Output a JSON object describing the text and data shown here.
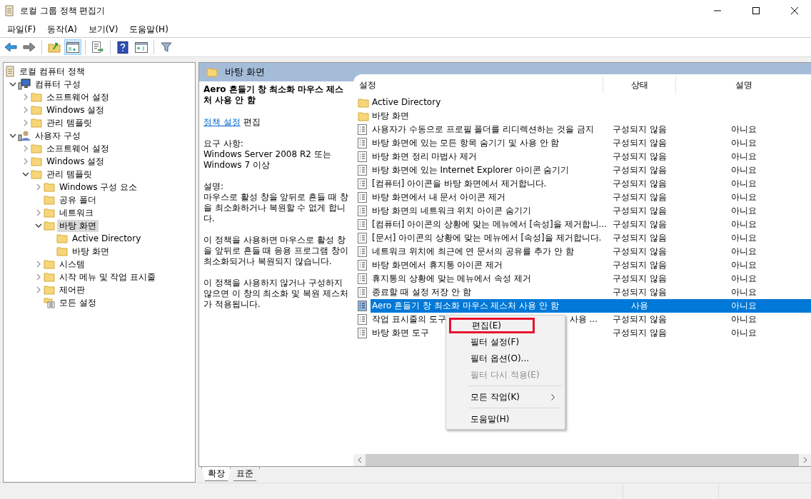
{
  "window": {
    "title": "로컬 그룹 정책 편집기"
  },
  "menu_bar": [
    "파일(F)",
    "동작(A)",
    "보기(V)",
    "도움말(H)"
  ],
  "toolbar": [
    {
      "kind": "back",
      "pressed": false
    },
    {
      "kind": "forward",
      "pressed": false
    },
    {
      "kind": "separator"
    },
    {
      "kind": "up",
      "pressed": false
    },
    {
      "kind": "tree",
      "pressed": true
    },
    {
      "kind": "separator"
    },
    {
      "kind": "export",
      "pressed": false
    },
    {
      "kind": "separator"
    },
    {
      "kind": "help",
      "pressed": false
    },
    {
      "kind": "pane",
      "pressed": false
    },
    {
      "kind": "separator"
    },
    {
      "kind": "filter",
      "pressed": false
    }
  ],
  "tree": {
    "label": "로컬 컴퓨터 정책",
    "kind": "policy",
    "selected": false,
    "children": [
      {
        "label": "컴퓨터 구성",
        "kind": "computer",
        "expanded": true,
        "selected": false,
        "children": [
          {
            "label": "소프트웨어 설정",
            "kind": "folder",
            "expanded": false,
            "selected": false
          },
          {
            "label": "Windows 설정",
            "kind": "folder",
            "expanded": false,
            "selected": false
          },
          {
            "label": "관리 템플릿",
            "kind": "folder",
            "expanded": false,
            "selected": false
          }
        ]
      },
      {
        "label": "사용자 구성",
        "kind": "user",
        "expanded": true,
        "selected": false,
        "children": [
          {
            "label": "소프트웨어 설정",
            "kind": "folder",
            "expanded": false,
            "selected": false
          },
          {
            "label": "Windows 설정",
            "kind": "folder",
            "expanded": false,
            "selected": false
          },
          {
            "label": "관리 템플릿",
            "kind": "folder",
            "expanded": true,
            "selected": false,
            "children": [
              {
                "label": "Windows 구성 요소",
                "kind": "folder",
                "expanded": false,
                "selected": false
              },
              {
                "label": "공유 폴더",
                "kind": "folder",
                "selected": false
              },
              {
                "label": "네트워크",
                "kind": "folder",
                "expanded": false,
                "selected": false
              },
              {
                "label": "바탕 화면",
                "kind": "folder",
                "expanded": true,
                "selected": true,
                "children": [
                  {
                    "label": "Active Directory",
                    "kind": "folder",
                    "selected": false
                  },
                  {
                    "label": "바탕 화면",
                    "kind": "folder",
                    "selected": false
                  }
                ]
              },
              {
                "label": "시스템",
                "kind": "folder",
                "expanded": false,
                "selected": false
              },
              {
                "label": "시작 메뉴 및 작업 표시줄",
                "kind": "folder",
                "expanded": false,
                "selected": false
              },
              {
                "label": "제어판",
                "kind": "folder",
                "expanded": false,
                "selected": false
              },
              {
                "label": "모든 설정",
                "kind": "all-settings",
                "selected": false
              }
            ]
          }
        ]
      }
    ]
  },
  "pane_header": "바탕 화면",
  "detail": {
    "title": "Aero 흔들기 창 최소화 마우스 제스처 사용 안 함",
    "link": "정책 설정",
    "link_suffix": "편집",
    "requirements_label": "요구 사항:",
    "requirements": "Windows Server 2008 R2 또는 Windows 7 이상",
    "description_label": "설명:",
    "paragraphs": [
      "마우스로 활성 창을 앞뒤로 흔들 때 창을 최소화하거나 복원할 수 없게 합니다.",
      "이 정책을 사용하면 마우스로 활성 창을 앞뒤로 흔들 때 응용 프로그램 창이 최소화되거나 복원되지 않습니다.",
      "이 정책을 사용하지 않거나 구성하지 않으면 이 창의 최소화 및 복원 제스처가 적용됩니다."
    ]
  },
  "table": {
    "columns": [
      "설정",
      "상태",
      "설명"
    ],
    "rows": [
      {
        "kind": "folder",
        "name": "Active Directory",
        "selected": false
      },
      {
        "kind": "folder",
        "name": "바탕 화면",
        "selected": false
      },
      {
        "kind": "setting",
        "name": "사용자가 수동으로 프로필 폴더를 리디렉션하는 것을 금지",
        "state": "구성되지 않음",
        "comment": "아니요",
        "selected": false
      },
      {
        "kind": "setting",
        "name": "바탕 화면에 있는 모든 항목 숨기기 및 사용 안 함",
        "state": "구성되지 않음",
        "comment": "아니요",
        "selected": false
      },
      {
        "kind": "setting",
        "name": "바탕 화면 정리 마법사 제거",
        "state": "구성되지 않음",
        "comment": "아니요",
        "selected": false
      },
      {
        "kind": "setting",
        "name": "바탕 화면에 있는 Internet Explorer 아이콘 숨기기",
        "state": "구성되지 않음",
        "comment": "아니요",
        "selected": false
      },
      {
        "kind": "setting",
        "name": "[컴퓨터] 아이콘을 바탕 화면에서 제거합니다.",
        "state": "구성되지 않음",
        "comment": "아니요",
        "selected": false
      },
      {
        "kind": "setting",
        "name": "바탕 화면에서 내 문서 아이콘 제거",
        "state": "구성되지 않음",
        "comment": "아니요",
        "selected": false
      },
      {
        "kind": "setting",
        "name": "바탕 화면의 네트워크 위치 아이콘 숨기기",
        "state": "구성되지 않음",
        "comment": "아니요",
        "selected": false
      },
      {
        "kind": "setting",
        "name": "[컴퓨터] 아이콘의 상황에 맞는 메뉴에서 [속성]을 제거합니...",
        "state": "구성되지 않음",
        "comment": "아니요",
        "selected": false
      },
      {
        "kind": "setting",
        "name": "[문서] 아이콘의 상황에 맞는 메뉴에서 [속성]을 제거합니다.",
        "state": "구성되지 않음",
        "comment": "아니요",
        "selected": false
      },
      {
        "kind": "setting",
        "name": "네트워크 위치에 최근에 연 문서의 공유를 추가 안 함",
        "state": "구성되지 않음",
        "comment": "아니요",
        "selected": false
      },
      {
        "kind": "setting",
        "name": "바탕 화면에서 휴지통 아이콘 제거",
        "state": "구성되지 않음",
        "comment": "아니요",
        "selected": false
      },
      {
        "kind": "setting",
        "name": "휴지통의 상황에 맞는 메뉴에서 속성 제거",
        "state": "구성되지 않음",
        "comment": "아니요",
        "selected": false
      },
      {
        "kind": "setting",
        "name": "종료할 때 설정 저장 안 함",
        "state": "구성되지 않음",
        "comment": "아니요",
        "selected": false
      },
      {
        "kind": "setting",
        "name": "Aero 흔들기 창 최소화 마우스 제스처 사용 안 함",
        "state": "사용",
        "comment": "아니요",
        "selected": true
      },
      {
        "kind": "setting",
        "name": "작업 표시줄의 도구",
        "name_tail": "사용 ...",
        "state": "구성되지 않음",
        "comment": "아니요",
        "selected": false
      },
      {
        "kind": "setting",
        "name": "바탕 화면 도구",
        "state": "구성되지 않음",
        "comment": "아니요",
        "selected": false
      }
    ]
  },
  "context_menu": [
    {
      "kind": "item",
      "label": "편집(E)",
      "disabled": false,
      "highlighted": true,
      "submenu": false
    },
    {
      "kind": "item",
      "label": "필터 설정(F)",
      "disabled": false,
      "highlighted": false,
      "submenu": false
    },
    {
      "kind": "item",
      "label": "필터 옵션(O)...",
      "disabled": false,
      "highlighted": false,
      "submenu": false
    },
    {
      "kind": "item",
      "label": "필터 다시 적용(E)",
      "disabled": true,
      "highlighted": false,
      "submenu": false
    },
    {
      "kind": "separator"
    },
    {
      "kind": "item",
      "label": "모든 작업(K)",
      "disabled": false,
      "highlighted": false,
      "submenu": true
    },
    {
      "kind": "separator"
    },
    {
      "kind": "item",
      "label": "도움말(H)",
      "disabled": false,
      "highlighted": false,
      "submenu": false
    }
  ],
  "view_tabs": [
    {
      "label": "확장",
      "selected": true
    },
    {
      "label": "표준",
      "selected": false
    }
  ]
}
